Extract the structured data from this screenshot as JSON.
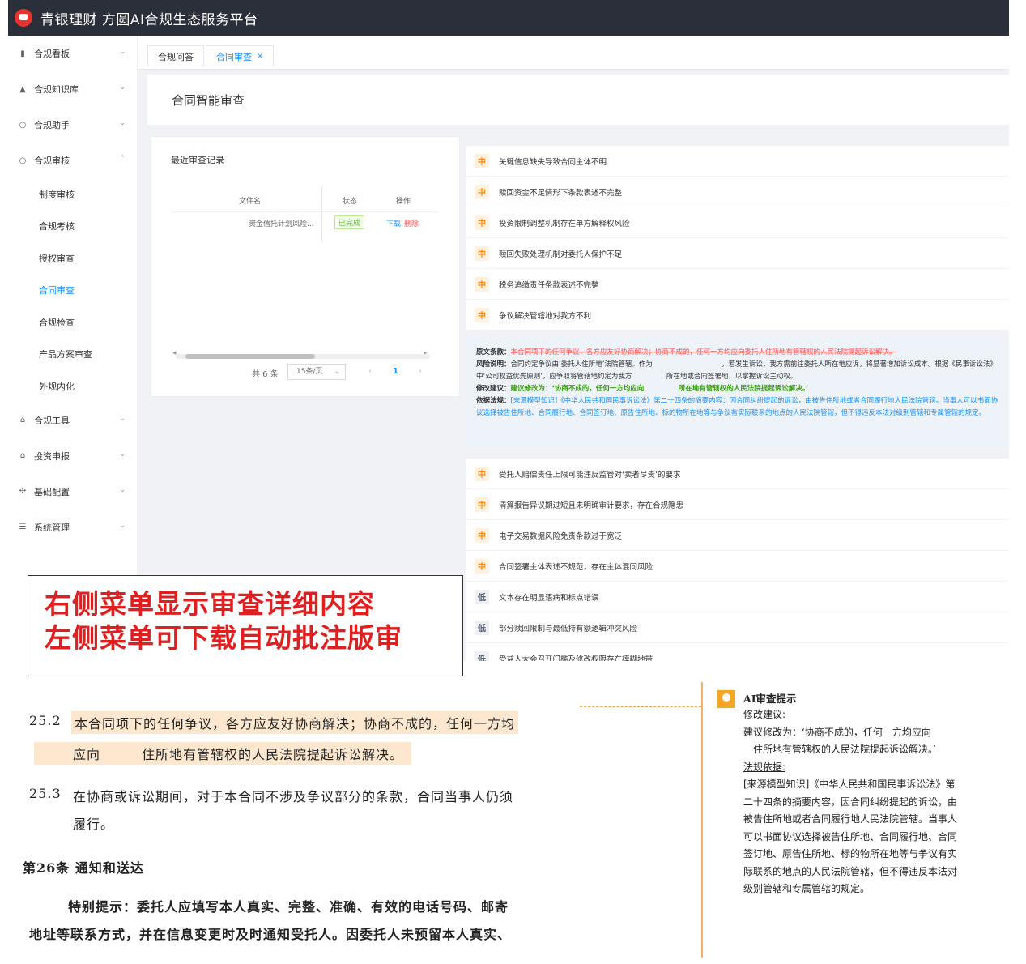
{
  "app": {
    "title": "青银理财 方圆AI合规生态服务平台"
  },
  "sidebar": {
    "items": [
      {
        "icon": "chart-icon",
        "label": "合规看板"
      },
      {
        "icon": "library-icon",
        "label": "合规知识库"
      },
      {
        "icon": "assistant-icon",
        "label": "合规助手"
      },
      {
        "icon": "review-icon",
        "label": "合规审核"
      }
    ],
    "sub_items": [
      {
        "label": "制度审核"
      },
      {
        "label": "合规考核"
      },
      {
        "label": "授权审查"
      },
      {
        "label": "合同审查"
      },
      {
        "label": "合规检查"
      },
      {
        "label": "产品方案审查"
      },
      {
        "label": "外规内化"
      }
    ],
    "items_bottom": [
      {
        "icon": "tools-icon",
        "label": "合规工具"
      },
      {
        "icon": "report-icon",
        "label": "投资申报"
      },
      {
        "icon": "config-icon",
        "label": "基础配置"
      },
      {
        "icon": "settings-icon",
        "label": "系统管理"
      }
    ]
  },
  "tabs": [
    {
      "label": "合规问答"
    },
    {
      "label": "合同审查"
    }
  ],
  "page": {
    "title": "合同智能审查"
  },
  "records": {
    "title": "最近审查记录",
    "columns": [
      "文件名",
      "状态",
      "操作"
    ],
    "rows": [
      {
        "file": "资金信托计划风险...",
        "status": "已完成",
        "download": "下载",
        "delete": "删除"
      }
    ],
    "total": "共 6 条",
    "page_size": "15条/页",
    "page": "1"
  },
  "risks_top": [
    {
      "level": "中",
      "text": "关键信息缺失导致合同主体不明"
    },
    {
      "level": "中",
      "text": "赎回资金不足情形下条款表述不完整"
    },
    {
      "level": "中",
      "text": "投资限制调整机制存在单方解释权风险"
    },
    {
      "level": "中",
      "text": "赎回失败处理机制对委托人保护不足"
    },
    {
      "level": "中",
      "text": "税务追缴责任条款表述不完整"
    },
    {
      "level": "中",
      "text": "争议解决管辖地对我方不利"
    }
  ],
  "detail": {
    "original_label": "原文条款：",
    "original_text": "本合同项下的任何争议，各方应友好协商解决；协商不成的，任何一方均应向委托人住所地有管辖权的人民法院提起诉讼解决。",
    "risk_label": "风险说明：",
    "risk_text": "合同约定争议由‘委托人住所地’法院管辖。作为　　　　　　　　　　，若发生诉讼，我方需前往委托人所在地应诉，将显著增加诉讼成本。根据《民事诉讼法》中‘公司权益优先原则’，应争取将管辖地约定为我方　　　　　所在地或合同签署地，以掌握诉讼主动权。",
    "suggest_label": "修改建议：",
    "suggest_text": "建议修改为：‘协商不成的，任何一方均应向　　　　　所在地有管辖权的人民法院提起诉讼解决。’",
    "basis_label": "依据法规：",
    "basis_text": "[来源模型知识]《中华人民共和国民事诉讼法》第二十四条的摘要内容：因合同纠纷提起的诉讼，由被告住所地或者合同履行地人民法院管辖。当事人可以书面协议选择被告住所地、合同履行地、合同签订地、原告住所地、标的物所在地等与争议有实际联系的地点的人民法院管辖，但不得违反本法对级别管辖和专属管辖的规定。"
  },
  "risks_bottom": [
    {
      "level": "中",
      "text": "受托人赔偿责任上限可能违反监管对‘卖者尽责’的要求"
    },
    {
      "level": "中",
      "text": "清算报告异议期过短且未明确审计要求，存在合规隐患"
    },
    {
      "level": "中",
      "text": "电子交易数据风险免责条款过于宽泛"
    },
    {
      "level": "中",
      "text": "合同签署主体表述不规范，存在主体混同风险"
    },
    {
      "level": "低",
      "text": "文本存在明显语病和标点错误"
    },
    {
      "level": "低",
      "text": "部分赎回限制与最低持有额逻辑冲突风险"
    },
    {
      "level": "低",
      "text": "受益人大会召开门槛及修改权限存在模糊地带"
    }
  ],
  "callout": {
    "line1": "右侧菜单显示审查详细内容",
    "line2": "左侧菜单可下载自动批注版审"
  },
  "document": {
    "clause_25_2_num": "25.2",
    "clause_25_2_line1": "本合同项下的任何争议，各方应友好协商解决；协商不成的，任何一方均",
    "clause_25_2_line2": "应向　　　住所地有管辖权的人民法院提起诉讼解决。",
    "clause_25_3_num": "25.3",
    "clause_25_3_line1": "在协商或诉讼期间，对于本合同不涉及争议部分的条款，合同当事人仍须",
    "clause_25_3_line2": "履行。",
    "article_26": "第26条  通知和送达",
    "notice_line1": "特别提示：委托人应填写本人真实、完整、准确、有效的电话号码、邮寄",
    "notice_line2": "地址等联系方式，并在信息变更时及时通知受托人。因委托人未预留本人真实、"
  },
  "ai_comment": {
    "title": "AI审查提示",
    "lines": [
      "修改建议:",
      "建议修改为：‘协商不成的，任何一方均应向",
      "　住所地有管辖权的人民法院提起诉讼解决。’",
      "法规依据:",
      "[来源模型知识]《中华人民共和国民事诉讼法》第",
      "二十四条的摘要内容，因合同纠纷提起的诉讼，由",
      "被告住所地或者合同履行地人民法院管辖。当事人",
      "可以书面协议选择被告住所地、合同履行地、合同",
      "签订地、原告住所地、标的物所在地等与争议有实",
      "际联系的地点的人民法院管辖，但不得违反本法对",
      "级别管辖和专属管辖的规定。"
    ]
  },
  "colors": {
    "topbar": "#2b2f3a",
    "accent": "#1890ff",
    "medium": "#fa8c16",
    "callout_text": "#e02020"
  }
}
